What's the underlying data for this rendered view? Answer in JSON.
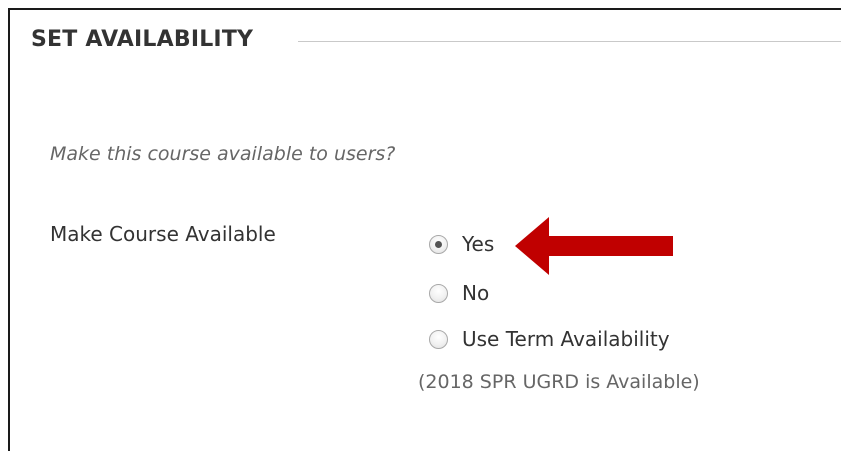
{
  "section": {
    "title": "SET AVAILABILITY"
  },
  "form": {
    "instructions": "Make this course available to users?",
    "field_label": "Make Course Available",
    "options": [
      {
        "label": "Yes",
        "selected": true
      },
      {
        "label": "No",
        "selected": false
      },
      {
        "label": "Use Term Availability",
        "selected": false
      }
    ],
    "term_note": "(2018 SPR UGRD is Available)"
  },
  "annotation": {
    "arrow_color": "#c00000",
    "arrow_icon": "left-arrow-icon"
  }
}
